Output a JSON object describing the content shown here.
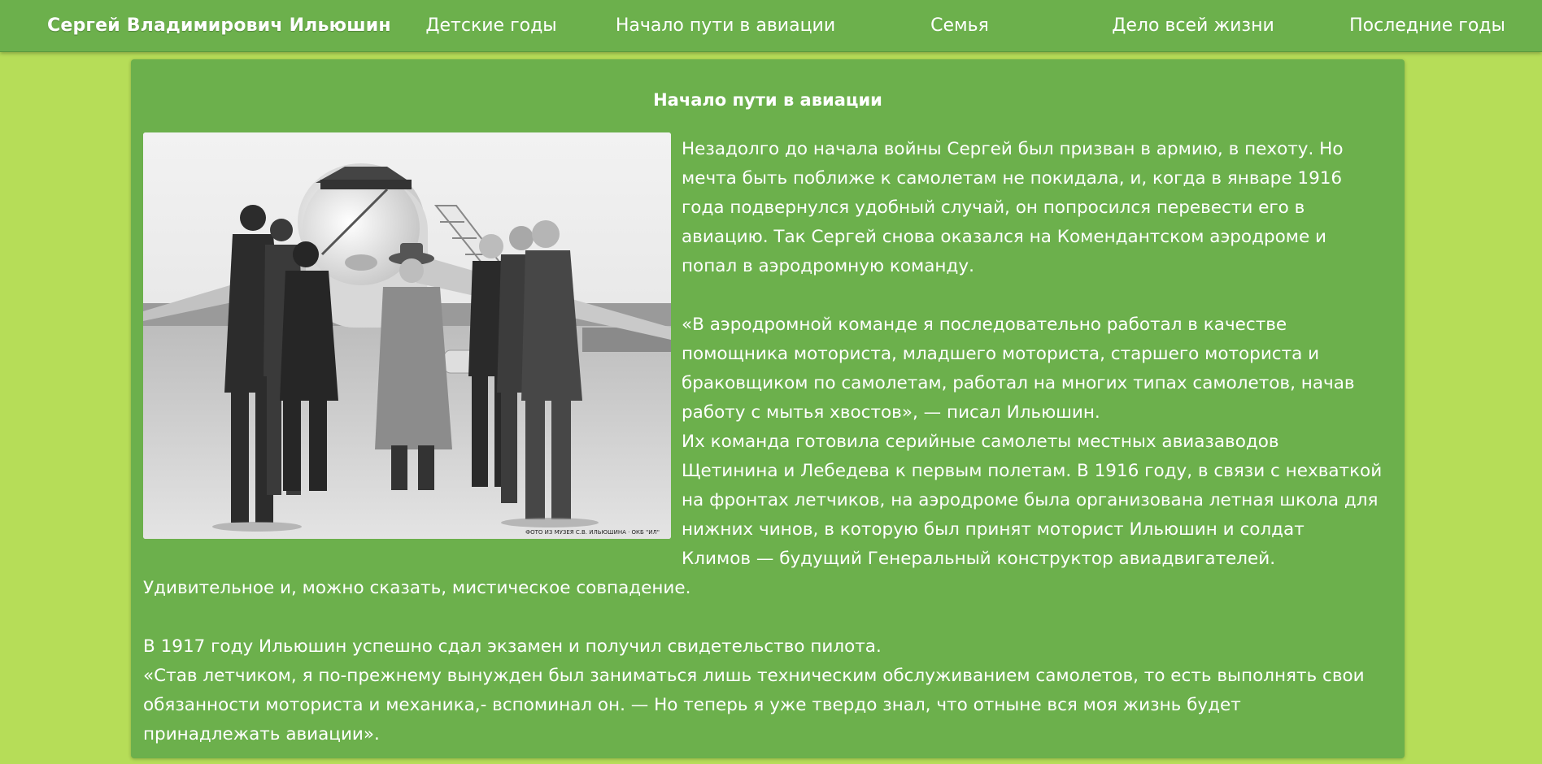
{
  "nav": {
    "brand": "Сергей Владимирович Ильюшин",
    "links": [
      "Детские годы",
      "Начало пути в авиации",
      "Семья",
      "Дело всей жизни",
      "Последние годы"
    ]
  },
  "section": {
    "title": "Начало пути в авиации"
  },
  "photo": {
    "caption": "ФОТО ИЗ МУЗЕЯ С.В. ИЛЬЮШИНА · ОКБ \"ИЛ\""
  },
  "article": {
    "lines_beside_photo": [
      "Незадолго до начала войны Сергей был призван в армию, в пехоту. Но",
      "мечта быть поближе к самолетам не покидала, и, когда в январе 1916",
      "года подвернулся удобный случай, он попросился перевести его в",
      "авиацию. Так Сергей снова оказался на Комендантском аэродроме и",
      "попал в аэродромную команду.",
      "",
      "«В аэродромной команде я последовательно работал в качестве",
      "помощника моториста, младшего моториста, старшего моториста и",
      "браковщиком по самолетам, работал на многих типах самолетов, начав",
      "работу с мытья хвостов», — писал Ильюшин.",
      "Их команда готовила серийные самолеты местных авиазаводов",
      "Щетинина и Лебедева к первым полетам. В 1916 году, в связи с нехваткой",
      "на фронтах летчиков, на аэродроме была организована летная школа для",
      "нижних чинов, в которую был принят моторист Ильюшин и солдат",
      "Климов — будущий Генеральный конструктор авиадвигателей."
    ],
    "lines_full_width": [
      "Удивительное и, можно сказать, мистическое совпадение.",
      "",
      "В 1917 году Ильюшин успешно сдал экзамен и получил свидетельство пилота.",
      "«Став летчиком, я по-прежнему вынужден был заниматься лишь техническим обслуживанием самолетов, то есть выполнять свои",
      "обязанности моториста и механика,- вспоминал он. — Но теперь я уже твердо знал, что отныне вся моя жизнь будет",
      "принадлежать авиации»."
    ]
  },
  "colors": {
    "page_background": "#b6dd58",
    "navbar": "#6cb04c",
    "card": "#6cb04c",
    "text": "#ffffff"
  }
}
